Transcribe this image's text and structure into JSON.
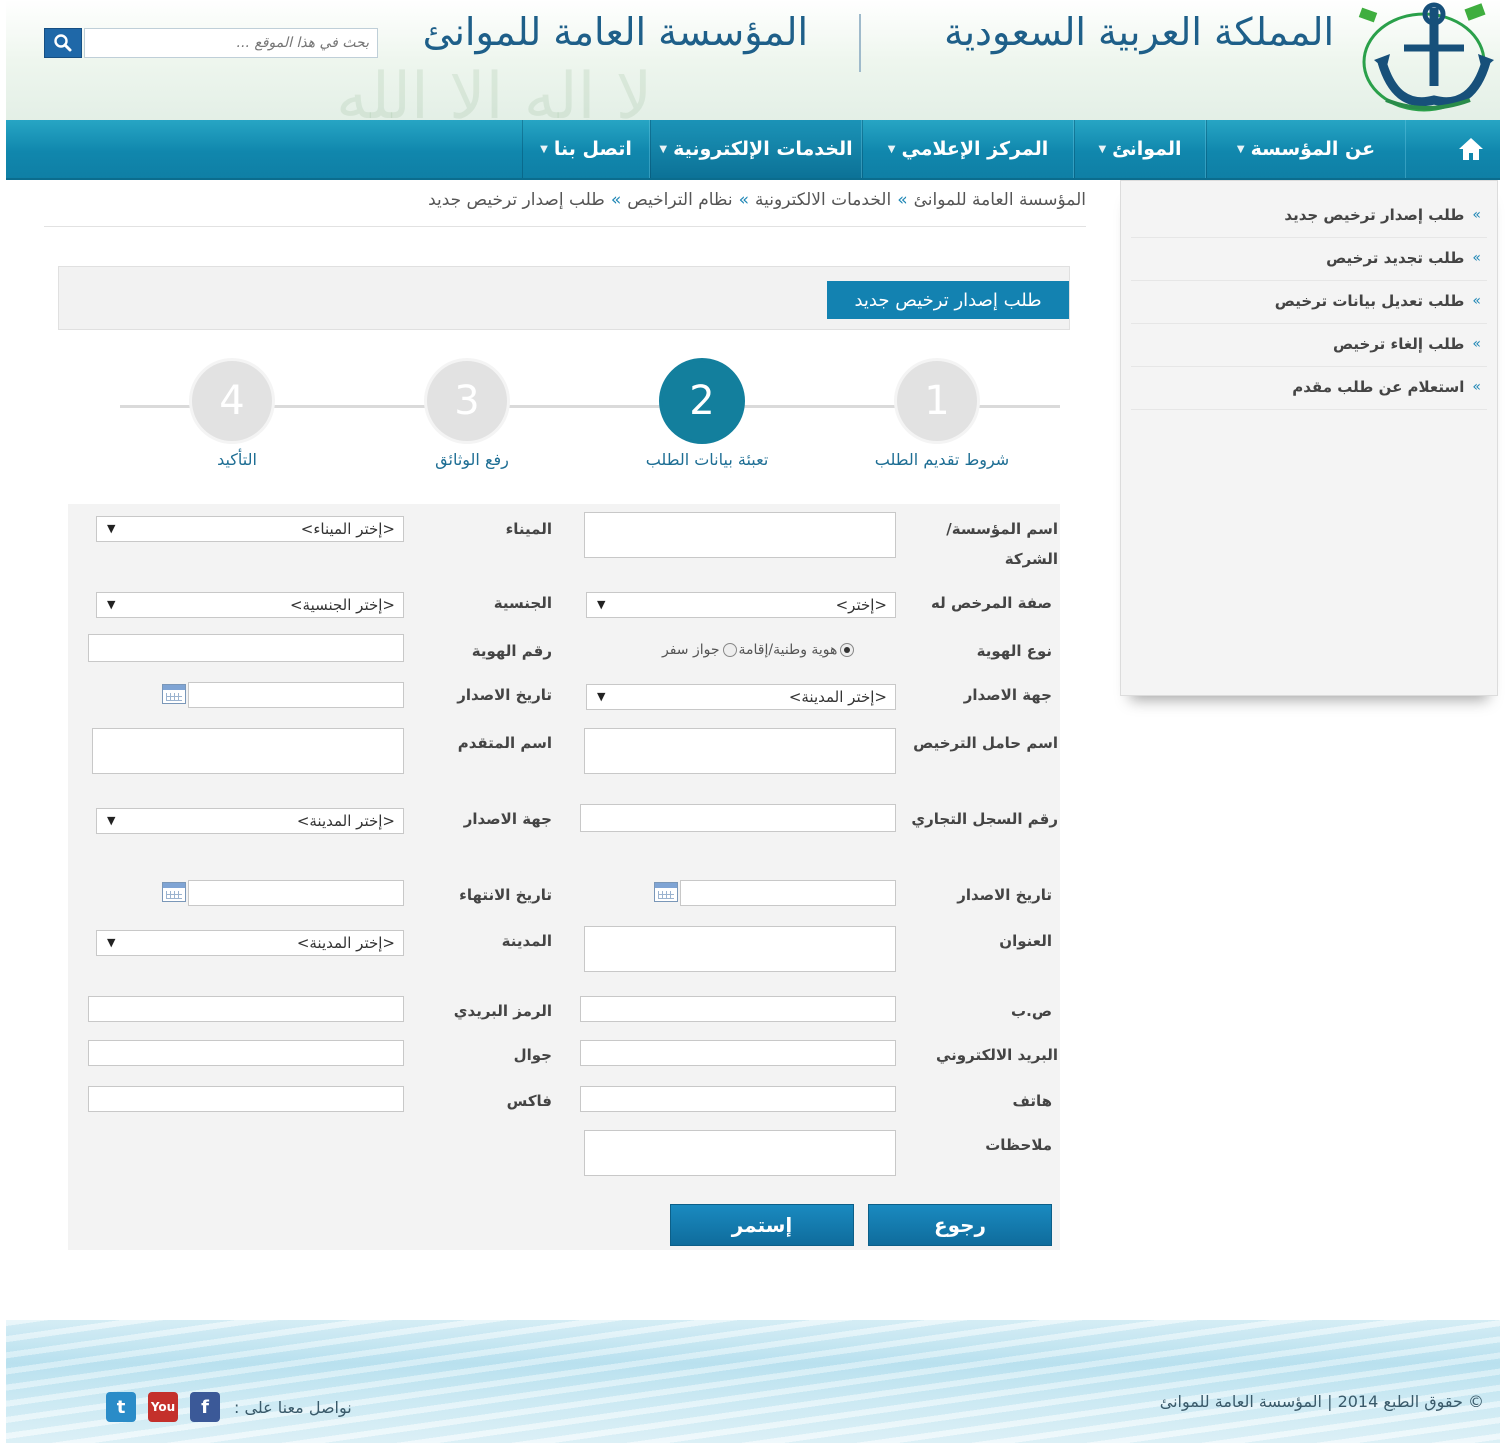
{
  "header": {
    "title_kingdom": "المملكة العربية السعودية",
    "title_org": "المؤسسة العامة للموانئ",
    "search_placeholder": "بحث في هذا الموقع ..."
  },
  "nav": {
    "items": [
      {
        "label": "عن المؤسسة"
      },
      {
        "label": "الموانئ"
      },
      {
        "label": "المركز الإعلامي"
      },
      {
        "label": "الخدمات الإلكترونية"
      },
      {
        "label": "اتصل بنا"
      }
    ],
    "active_index": 3
  },
  "breadcrumb": {
    "items": [
      "المؤسسة العامة للموانئ",
      "الخدمات الالكترونية",
      "نظام التراخيص",
      "طلب إصدار ترخيص جديد"
    ],
    "separator": "»"
  },
  "sidebar": {
    "items": [
      {
        "label": "طلب إصدار ترخيص جديد"
      },
      {
        "label": "طلب تجديد ترخيص"
      },
      {
        "label": "طلب تعديل بيانات ترخيص"
      },
      {
        "label": "طلب إلغاء ترخيص"
      },
      {
        "label": "استعلام عن طلب مقدم"
      }
    ],
    "bullet": "»"
  },
  "form": {
    "title": "طلب إصدار ترخيص جديد",
    "steps": [
      {
        "number": "1",
        "label": "شروط تقديم الطلب"
      },
      {
        "number": "2",
        "label": "تعبئة بيانات الطلب"
      },
      {
        "number": "3",
        "label": "رفع الوثائق"
      },
      {
        "number": "4",
        "label": "التأكيد"
      }
    ],
    "active_step": 2,
    "labels": {
      "company_name": "اسم المؤسسة/ الشركة",
      "port": "الميناء",
      "licensee_role": "صفة المرخص له",
      "nationality": "الجنسية",
      "id_type": "نوع الهوية",
      "id_number": "رقم الهوية",
      "issue_authority": "جهة الاصدار",
      "issue_date": "تاريخ الاصدار",
      "license_holder": "اسم حامل الترخيص",
      "applicant_name": "اسم المتقدم",
      "cr_number": "رقم السجل التجاري",
      "cr_issue_authority": "جهة الاصدار",
      "cr_issue_date": "تاريخ الاصدار",
      "cr_expiry_date": "تاريخ الانتهاء",
      "address": "العنوان",
      "city": "المدينة",
      "po_box": "ص.ب",
      "postal_code": "الرمز البريدي",
      "email": "البريد الالكتروني",
      "mobile": "جوال",
      "phone": "هاتف",
      "fax": "فاكس",
      "notes": "ملاحظات"
    },
    "selects": {
      "port": "<إختر الميناء>",
      "licensee_role": "<إختر>",
      "nationality": "<إختر الجنسية>",
      "issue_authority": "<إختر المدينة>",
      "cr_issue_authority": "<إختر المدينة>",
      "city": "<إختر المدينة>"
    },
    "id_type_options": [
      {
        "label": "هوية وطنية/إقامة",
        "selected": true
      },
      {
        "label": "جواز سفر",
        "selected": false
      }
    ],
    "buttons": {
      "back": "رجوع",
      "continue": "إستمر"
    }
  },
  "footer": {
    "copyright": "© حقوق الطبع 2014 | المؤسسة العامة للموانئ",
    "follow_us": "نواصل معنا على :",
    "social": [
      "facebook-icon",
      "youtube-icon",
      "twitter-icon"
    ]
  }
}
